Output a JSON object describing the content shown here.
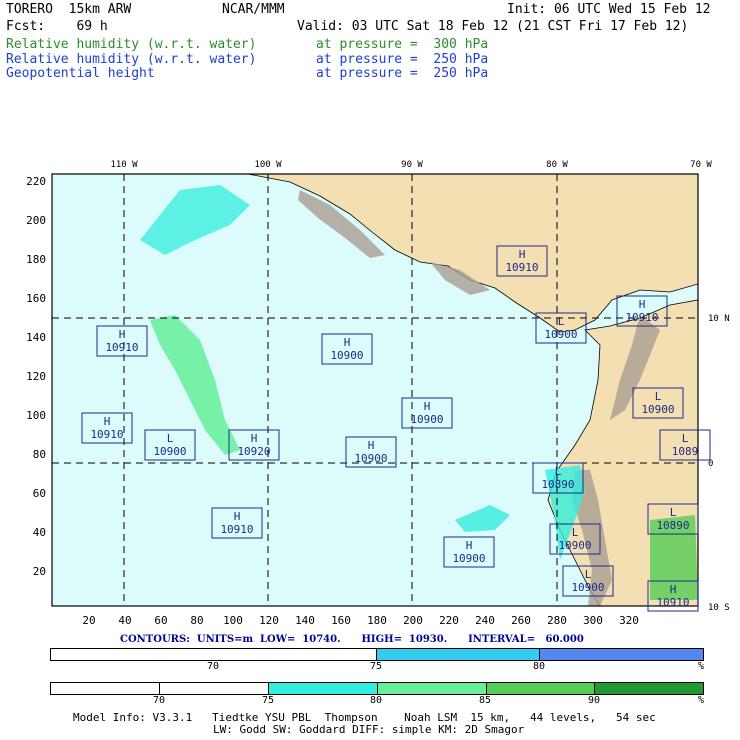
{
  "header": {
    "model_name": "TORERO  15km ARW",
    "org": "NCAR/MMM",
    "init": "Init: 06 UTC Wed 15 Feb 12",
    "forecast": "Fcst:    69 h",
    "valid": "Valid: 03 UTC Sat 18 Feb 12 (21 CST Fri 17 Feb 12)",
    "fields": [
      {
        "name": "Relative humidity (w.r.t. water)",
        "level": "at pressure =  300 hPa",
        "color": "#2e8b2e"
      },
      {
        "name": "Relative humidity (w.r.t. water)",
        "level": "at pressure =  250 hPa",
        "color": "#1f3fcf"
      },
      {
        "name": "Geopotential height",
        "level": "at pressure =  250 hPa",
        "color": "#1f3fcf"
      }
    ]
  },
  "map": {
    "colors": {
      "ocean": "#dcfbfb",
      "land": "#f3dfb2",
      "mountain": "#a99f92",
      "boundary": "#000000",
      "label_box": "#1a2a8c",
      "label_text": "#1a2a8c"
    },
    "top_lon_labels": [
      "110 W",
      "100 W",
      "90 W",
      "80 W",
      "70 W"
    ],
    "right_lat_labels": [
      "10 N",
      "0",
      "10 S"
    ],
    "y_ticks": [
      "220",
      "200",
      "180",
      "160",
      "140",
      "120",
      "100",
      "80",
      "60",
      "40",
      "20"
    ],
    "x_ticks": [
      "20",
      "40",
      "60",
      "80",
      "100",
      "120",
      "140",
      "160",
      "180",
      "200",
      "220",
      "240",
      "260",
      "280",
      "300",
      "320"
    ],
    "centers": [
      {
        "type": "H",
        "value": "10910"
      },
      {
        "type": "H",
        "value": "10910"
      },
      {
        "type": "H",
        "value": "10910"
      },
      {
        "type": "H",
        "value": "10900"
      },
      {
        "type": "H",
        "value": "10900"
      },
      {
        "type": "L",
        "value": "10900"
      },
      {
        "type": "H",
        "value": "10910"
      },
      {
        "type": "H",
        "value": "10900"
      },
      {
        "type": "L",
        "value": "10900"
      },
      {
        "type": "H",
        "value": "10920"
      },
      {
        "type": "H",
        "value": "10900"
      },
      {
        "type": "L",
        "value": "1089"
      },
      {
        "type": "L",
        "value": "10890"
      },
      {
        "type": "H",
        "value": "10910"
      },
      {
        "type": "L",
        "value": "10890"
      },
      {
        "type": "L",
        "value": "10900"
      },
      {
        "type": "L",
        "value": "10900"
      },
      {
        "type": "L",
        "value": "10900"
      },
      {
        "type": "H",
        "value": "10910"
      }
    ]
  },
  "contours_line": "CONTOURS:  UNITS=m  LOW=  10740.      HIGH=  10930.      INTERVAL=   60.000",
  "colorbar_250": {
    "segments": [
      {
        "from": "",
        "to": "75",
        "color": "#ffffff"
      },
      {
        "from": "75",
        "to": "80",
        "color": "#33ccee"
      },
      {
        "from": "80",
        "to": "",
        "color": "#5588ee"
      }
    ],
    "labels": [
      "70",
      "75",
      "80"
    ],
    "unit": "%"
  },
  "colorbar_300": {
    "segments": [
      {
        "color": "#ffffff"
      },
      {
        "color": "#ffffff"
      },
      {
        "color": "#33eedd"
      },
      {
        "color": "#66ee99"
      },
      {
        "color": "#55cc55"
      },
      {
        "color": "#229933"
      }
    ],
    "labels": [
      "70",
      "75",
      "80",
      "85",
      "90"
    ],
    "unit": "%"
  },
  "model_info": {
    "line1": "Model Info: V3.3.1   Tiedtke YSU PBL  Thompson    Noah LSM  15 km,   44 levels,   54 sec",
    "line2": "LW: Godd SW: Goddard DIFF: simple KM: 2D Smagor"
  }
}
